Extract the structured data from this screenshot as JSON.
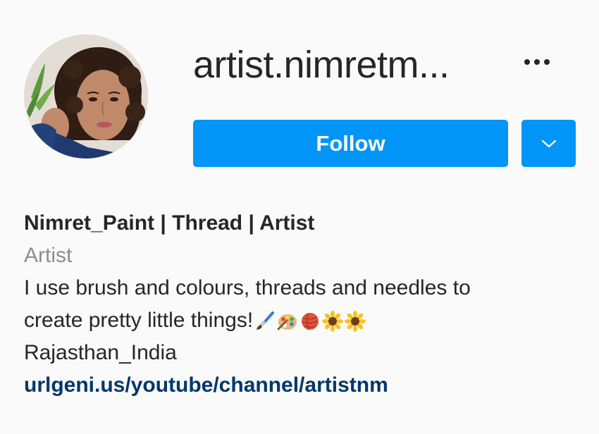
{
  "profile": {
    "username": "artist.nimretm...",
    "follow_label": "Follow",
    "display_name": "Nimret_Paint | Thread | Artist",
    "category": "Artist",
    "bio_line1": "I use brush and colours, threads and needles to",
    "bio_line2": "create pretty little things!",
    "bio_emojis": [
      "paintbrush-icon",
      "palette-icon",
      "yarn-icon",
      "sunflower-icon",
      "sunflower-icon"
    ],
    "location": "Rajasthan_India",
    "link": "urlgeni.us/youtube/channel/artistnm"
  },
  "colors": {
    "background": "#fafafa",
    "primary_button": "#0095f6",
    "text": "#262626",
    "muted_text": "#8e8e8e",
    "link": "#00376b"
  }
}
